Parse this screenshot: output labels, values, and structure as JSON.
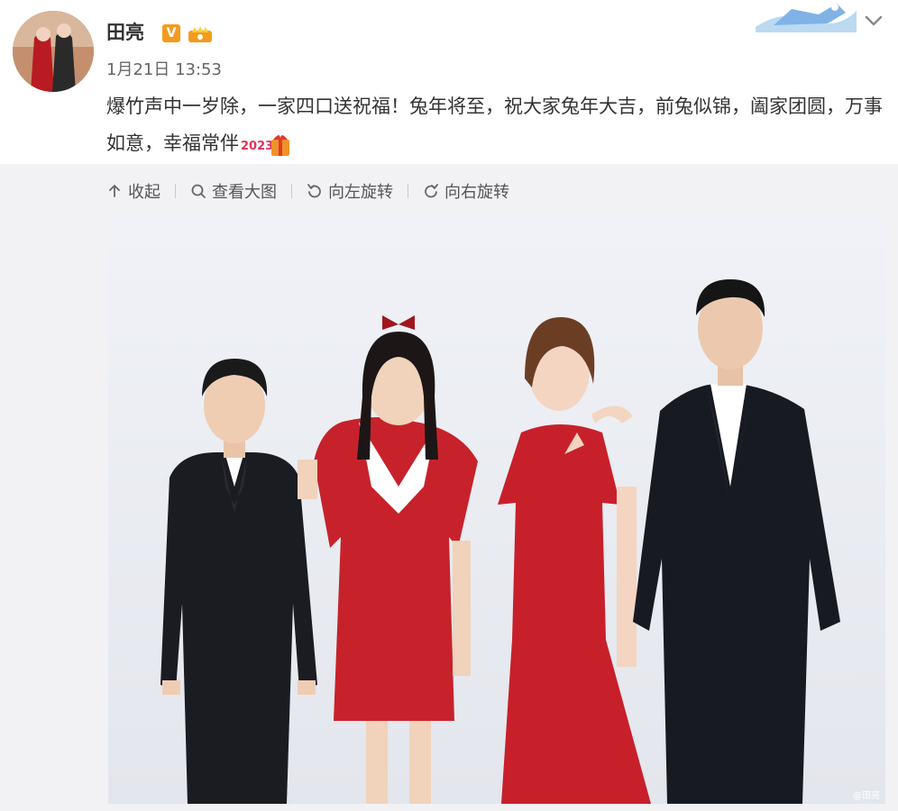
{
  "post": {
    "author": "田亮",
    "verified_badge": "V",
    "timestamp": "1月21日 13:53",
    "text": "爆竹声中一岁除，一家四口送祝福！兔年将至，祝大家兔年大吉，前兔似锦，阖家团圆，万事如意，幸福常伴",
    "emoji_text": "2023"
  },
  "toolbar": {
    "collapse_label": "收起",
    "view_large_label": "查看大图",
    "rotate_left_label": "向左旋转",
    "rotate_right_label": "向右旋转"
  },
  "photo": {
    "watermark": "@田亮"
  },
  "colors": {
    "accent_orange": "#f39b1d",
    "dress_red": "#c8202a",
    "panel_gray": "#f2f2f5"
  },
  "icons": [
    "collapse-arrow-icon",
    "search-icon",
    "rotate-left-icon",
    "rotate-right-icon",
    "chevron-down-icon",
    "crown-icon"
  ]
}
